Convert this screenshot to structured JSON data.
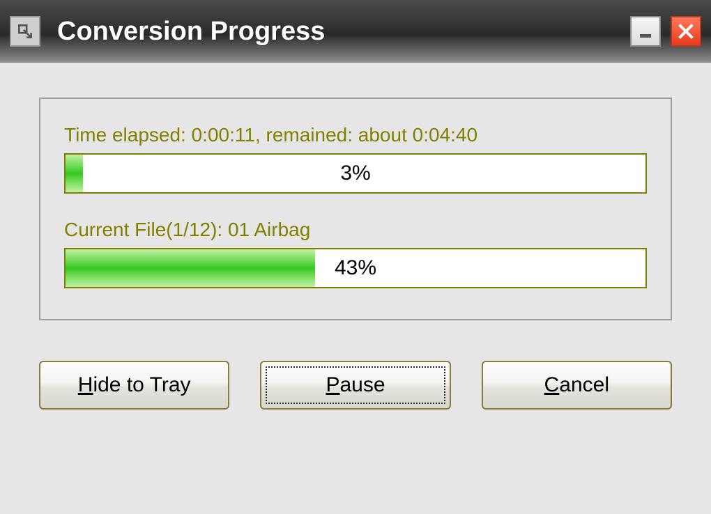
{
  "window": {
    "title": "Conversion Progress"
  },
  "panel": {
    "overall": {
      "label": "Time elapsed: 0:00:11, remained: about 0:04:40",
      "percent_text": "3%",
      "percent_value": 3
    },
    "current": {
      "label": "Current File(1/12): 01 Airbag",
      "percent_text": "43%",
      "percent_value": 43
    }
  },
  "buttons": {
    "hide": {
      "prefix": "H",
      "rest": "ide to Tray"
    },
    "pause": {
      "prefix": "P",
      "rest": "ause"
    },
    "cancel": {
      "prefix": "C",
      "rest": "ancel"
    }
  }
}
